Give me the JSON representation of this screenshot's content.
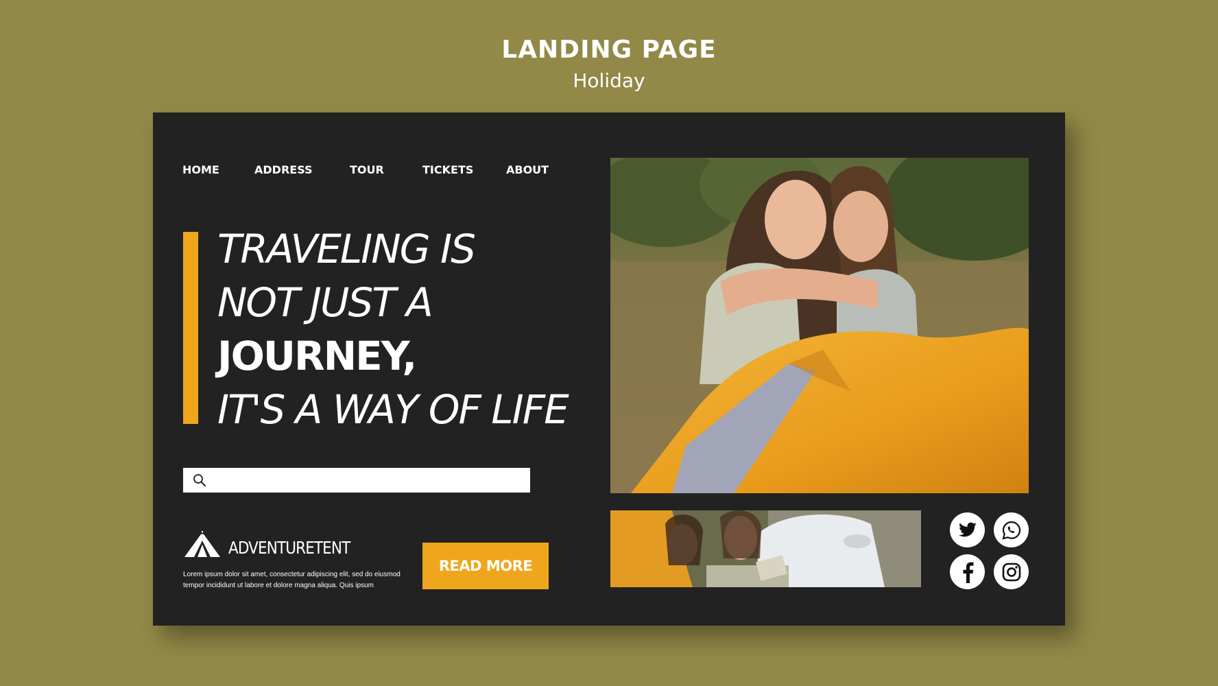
{
  "header": {
    "title": "LANDING PAGE",
    "subtitle": "Holiday"
  },
  "nav": {
    "items": [
      {
        "label": "HOME"
      },
      {
        "label": "ADDRESS"
      },
      {
        "label": "TOUR"
      },
      {
        "label": "TICKETS"
      },
      {
        "label": "ABOUT"
      }
    ]
  },
  "hero": {
    "line1": "TRAVELING IS",
    "line2": "NOT JUST A",
    "line3": "JOURNEY,",
    "line4": "IT'S A WAY OF LIFE"
  },
  "search": {
    "placeholder": "",
    "value": "",
    "icon": "search-icon"
  },
  "brand": {
    "name": "ADVENTURETENT",
    "icon": "tent-icon",
    "description": "Lorem ipsum dolor sit amet, consectetur adipiscing elit, sed do eiusmod tempor incididunt ut labore et dolore magna aliqua. Quis ipsum"
  },
  "cta": {
    "label": "READ MORE"
  },
  "social": [
    {
      "icon": "twitter-icon"
    },
    {
      "icon": "whatsapp-icon"
    },
    {
      "icon": "facebook-icon"
    },
    {
      "icon": "instagram-icon"
    }
  ],
  "colors": {
    "background": "#928847",
    "card": "#222222",
    "accent": "#f0a61c",
    "text": "#ffffff"
  }
}
